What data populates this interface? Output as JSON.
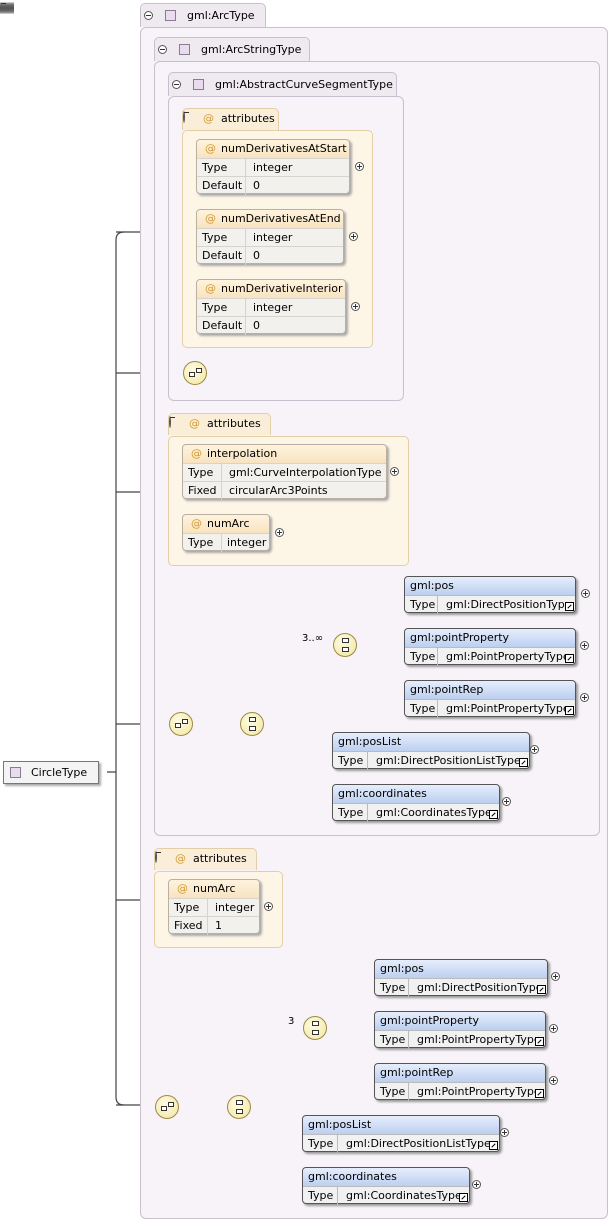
{
  "root": {
    "label": "CircleType"
  },
  "types": {
    "arc": "gml:ArcType",
    "arcString": "gml:ArcStringType",
    "abstractCurve": "gml:AbstractCurveSegmentType"
  },
  "attr_header": "attributes",
  "abstract_attrs": [
    {
      "name": "numDerivativesAtStart",
      "type_key": "Type",
      "type_val": "integer",
      "k2": "Default",
      "v2": "0"
    },
    {
      "name": "numDerivativesAtEnd",
      "type_key": "Type",
      "type_val": "integer",
      "k2": "Default",
      "v2": "0"
    },
    {
      "name": "numDerivativeInterior",
      "type_key": "Type",
      "type_val": "integer",
      "k2": "Default",
      "v2": "0"
    }
  ],
  "arcstring_attrs": [
    {
      "name": "interpolation",
      "type_key": "Type",
      "type_val": "gml:CurveInterpolationType",
      "k2": "Fixed",
      "v2": "circularArc3Points"
    },
    {
      "name": "numArc",
      "type_key": "Type",
      "type_val": "integer"
    }
  ],
  "arc_attrs": [
    {
      "name": "numArc",
      "type_key": "Type",
      "type_val": "integer",
      "k2": "Fixed",
      "v2": "1"
    }
  ],
  "arcstring_occurs": "3..∞",
  "arc_occurs": "3",
  "arcstring_elements": [
    {
      "name": "gml:pos",
      "type_key": "Type",
      "type_val": "gml:DirectPositionType"
    },
    {
      "name": "gml:pointProperty",
      "type_key": "Type",
      "type_val": "gml:PointPropertyType"
    },
    {
      "name": "gml:pointRep",
      "type_key": "Type",
      "type_val": "gml:PointPropertyType"
    },
    {
      "name": "gml:posList",
      "type_key": "Type",
      "type_val": "gml:DirectPositionListType"
    },
    {
      "name": "gml:coordinates",
      "type_key": "Type",
      "type_val": "gml:CoordinatesType"
    }
  ],
  "arc_elements": [
    {
      "name": "gml:pos",
      "type_key": "Type",
      "type_val": "gml:DirectPositionType"
    },
    {
      "name": "gml:pointProperty",
      "type_key": "Type",
      "type_val": "gml:PointPropertyType"
    },
    {
      "name": "gml:pointRep",
      "type_key": "Type",
      "type_val": "gml:PointPropertyType"
    },
    {
      "name": "gml:posList",
      "type_key": "Type",
      "type_val": "gml:DirectPositionListType"
    },
    {
      "name": "gml:coordinates",
      "type_key": "Type",
      "type_val": "gml:CoordinatesType"
    }
  ],
  "colors": {
    "frame": "#f7f3f8",
    "attr": "#fdf5e6",
    "element_header": "#bccff0",
    "compositor": "#f1e6a2"
  }
}
